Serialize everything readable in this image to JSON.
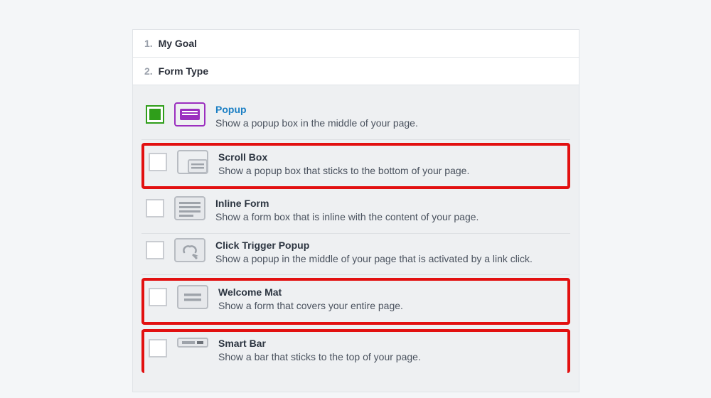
{
  "steps": {
    "step1": {
      "num": "1.",
      "label": "My Goal"
    },
    "step2": {
      "num": "2.",
      "label": "Form Type"
    }
  },
  "form_types": {
    "popup": {
      "title": "Popup",
      "desc": "Show a popup box in the middle of your page."
    },
    "scroll_box": {
      "title": "Scroll Box",
      "desc": "Show a popup box that sticks to the bottom of your page."
    },
    "inline_form": {
      "title": "Inline Form",
      "desc": "Show a form box that is inline with the content of your page."
    },
    "click_trigger": {
      "title": "Click Trigger Popup",
      "desc": "Show a popup in the middle of your page that is activated by a link click."
    },
    "welcome_mat": {
      "title": "Welcome Mat",
      "desc": "Show a form that covers your entire page."
    },
    "smart_bar": {
      "title": "Smart Bar",
      "desc": "Show a bar that sticks to the top of your page."
    }
  },
  "colors": {
    "selected_border": "#9b2fbf",
    "selected_text": "#1b7fc4",
    "check_green": "#2f9e1a",
    "highlight": "#e21010"
  }
}
